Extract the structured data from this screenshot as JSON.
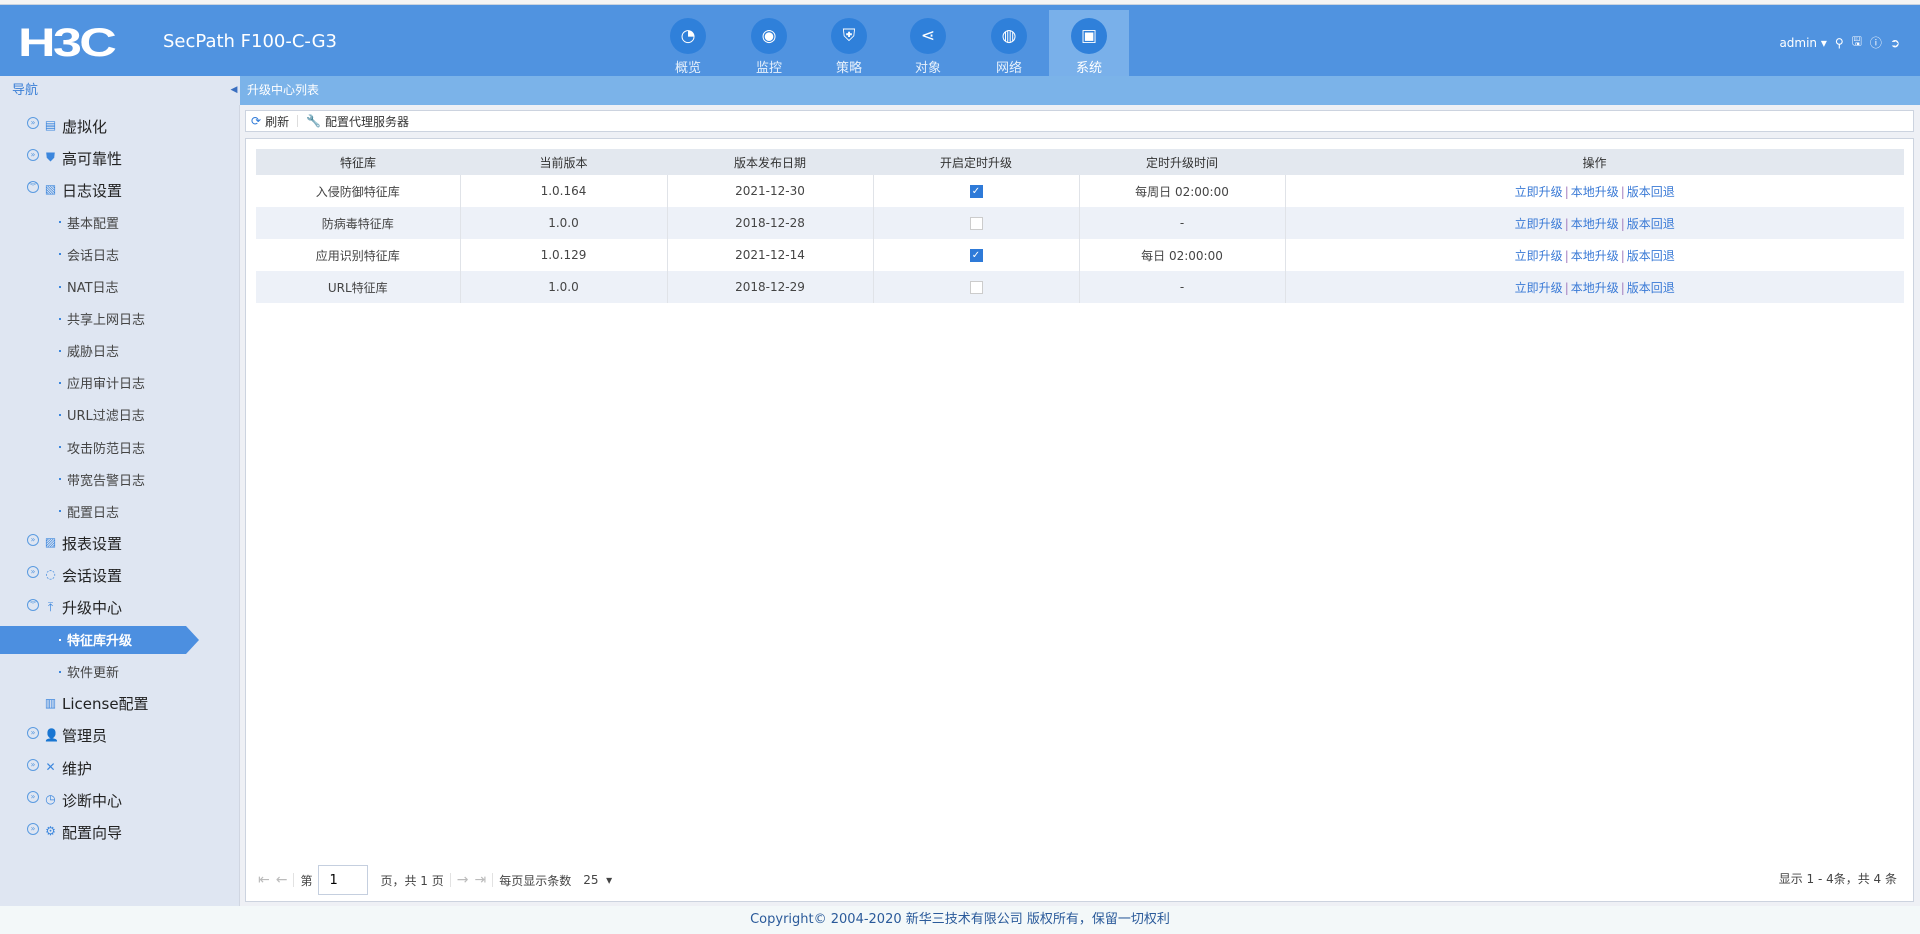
{
  "header": {
    "logo": "H3C",
    "product": "SecPath F100-C-G3",
    "tabs": [
      {
        "label": "概览",
        "icon": "gauge-icon"
      },
      {
        "label": "监控",
        "icon": "camera-icon"
      },
      {
        "label": "策略",
        "icon": "shield-icon"
      },
      {
        "label": "对象",
        "icon": "share-icon"
      },
      {
        "label": "网络",
        "icon": "globe-icon"
      },
      {
        "label": "系统",
        "icon": "monitor-icon",
        "active": true
      }
    ],
    "user": "admin"
  },
  "nav": {
    "title": "导航",
    "items": [
      {
        "label": "虚拟化",
        "level": 1
      },
      {
        "label": "高可靠性",
        "level": 1
      },
      {
        "label": "日志设置",
        "level": 1,
        "expanded": true
      },
      {
        "label": "基本配置",
        "level": 2
      },
      {
        "label": "会话日志",
        "level": 2
      },
      {
        "label": "NAT日志",
        "level": 2
      },
      {
        "label": "共享上网日志",
        "level": 2
      },
      {
        "label": "威胁日志",
        "level": 2
      },
      {
        "label": "应用审计日志",
        "level": 2
      },
      {
        "label": "URL过滤日志",
        "level": 2
      },
      {
        "label": "攻击防范日志",
        "level": 2
      },
      {
        "label": "带宽告警日志",
        "level": 2
      },
      {
        "label": "配置日志",
        "level": 2
      },
      {
        "label": "报表设置",
        "level": 1
      },
      {
        "label": "会话设置",
        "level": 1
      },
      {
        "label": "升级中心",
        "level": 1,
        "expanded": true
      },
      {
        "label": "特征库升级",
        "level": 2,
        "active": true
      },
      {
        "label": "软件更新",
        "level": 2
      },
      {
        "label": "License配置",
        "level": 1
      },
      {
        "label": "管理员",
        "level": 1
      },
      {
        "label": "维护",
        "level": 1
      },
      {
        "label": "诊断中心",
        "level": 1
      },
      {
        "label": "配置向导",
        "level": 1
      }
    ]
  },
  "content": {
    "title": "升级中心列表",
    "toolbar": {
      "refresh": "刷新",
      "proxy": "配置代理服务器"
    },
    "columns": [
      "特征库",
      "当前版本",
      "版本发布日期",
      "开启定时升级",
      "定时升级时间",
      "操作"
    ],
    "rows": [
      {
        "name": "入侵防御特征库",
        "version": "1.0.164",
        "date": "2021-12-30",
        "scheduled": true,
        "time": "每周日 02:00:00"
      },
      {
        "name": "防病毒特征库",
        "version": "1.0.0",
        "date": "2018-12-28",
        "scheduled": false,
        "time": "-"
      },
      {
        "name": "应用识别特征库",
        "version": "1.0.129",
        "date": "2021-12-14",
        "scheduled": true,
        "time": "每日 02:00:00"
      },
      {
        "name": "URL特征库",
        "version": "1.0.0",
        "date": "2018-12-29",
        "scheduled": false,
        "time": "-"
      }
    ],
    "actions": [
      "立即升级",
      "本地升级",
      "版本回退"
    ],
    "pager": {
      "page_prefix": "第",
      "page": "1",
      "page_suffix": "页，共 1 页",
      "per_page_label": "每页显示条数",
      "per_page": "25",
      "summary": "显示 1 - 4条，共 4 条"
    }
  },
  "footer": "Copyright© 2004-2020 新华三技术有限公司 版权所有，保留一切权利"
}
